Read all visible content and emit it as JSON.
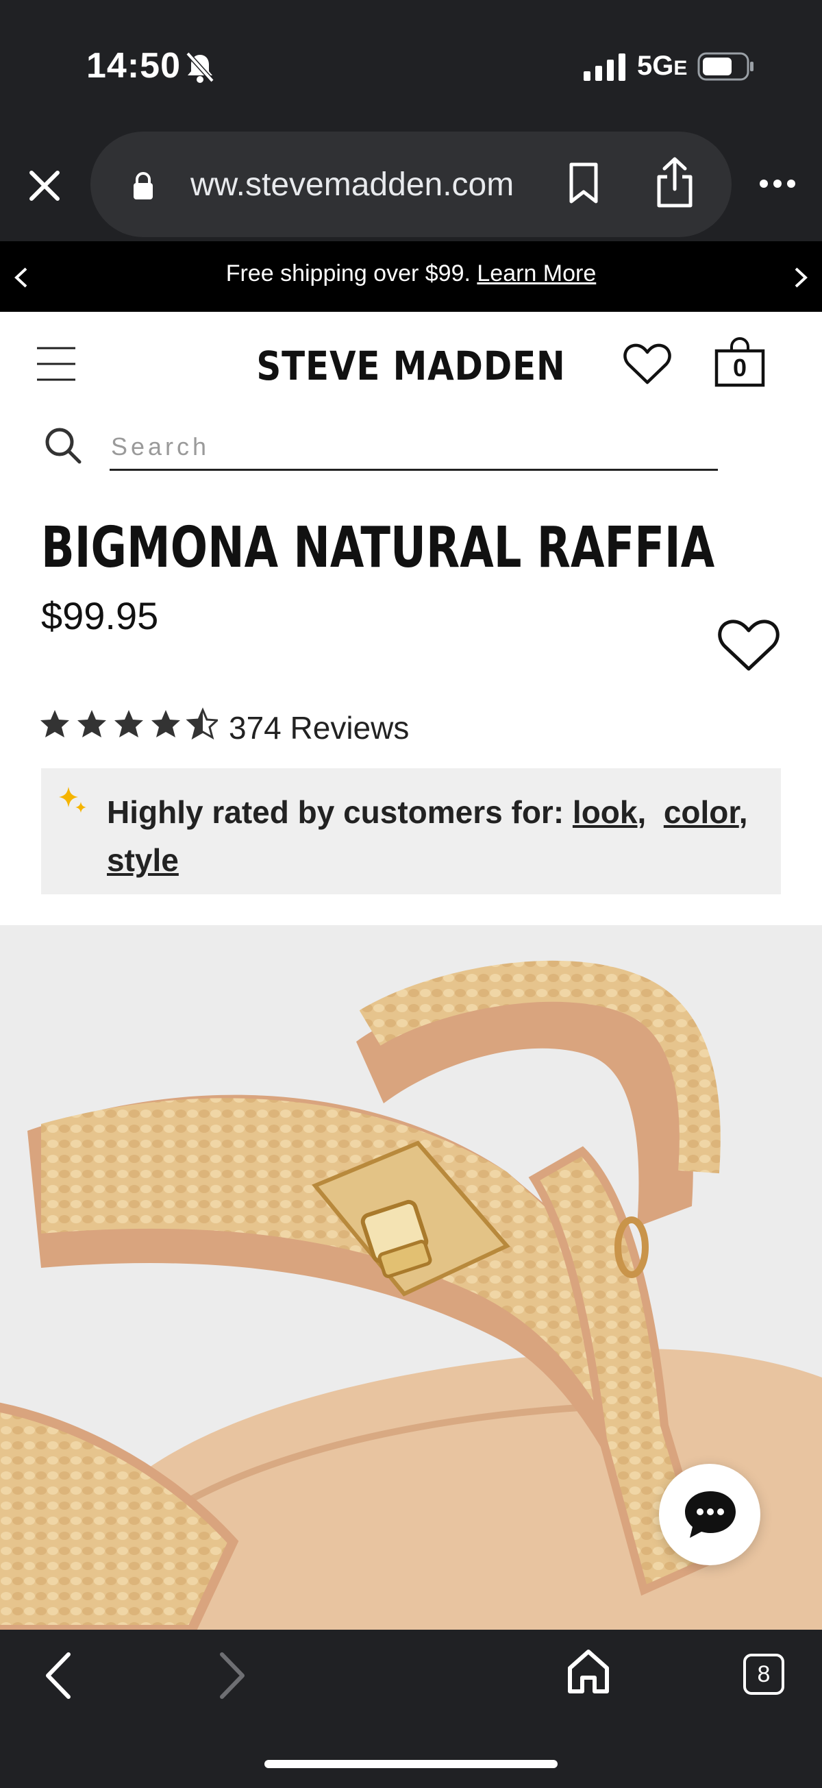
{
  "status_bar": {
    "time": "14:50",
    "network": "5G",
    "network_suffix": "E"
  },
  "browser": {
    "url": "ww.stevemadden.com",
    "tab_count": "8"
  },
  "promo": {
    "text": "Free shipping over $99. ",
    "link": "Learn More"
  },
  "header": {
    "brand": "STEVE MADDEN",
    "cart_count": "0"
  },
  "search": {
    "placeholder": "Search"
  },
  "product": {
    "title": "BIGMONA NATURAL RAFFIA",
    "price": "$99.95",
    "rating": 4.5,
    "reviews": "374 Reviews",
    "rated_prefix": "Highly rated by customers for: ",
    "rated_tags": [
      "look",
      "color",
      "style"
    ]
  },
  "colors": {
    "accent_star": "#f5b400",
    "chrome": "#202124"
  }
}
